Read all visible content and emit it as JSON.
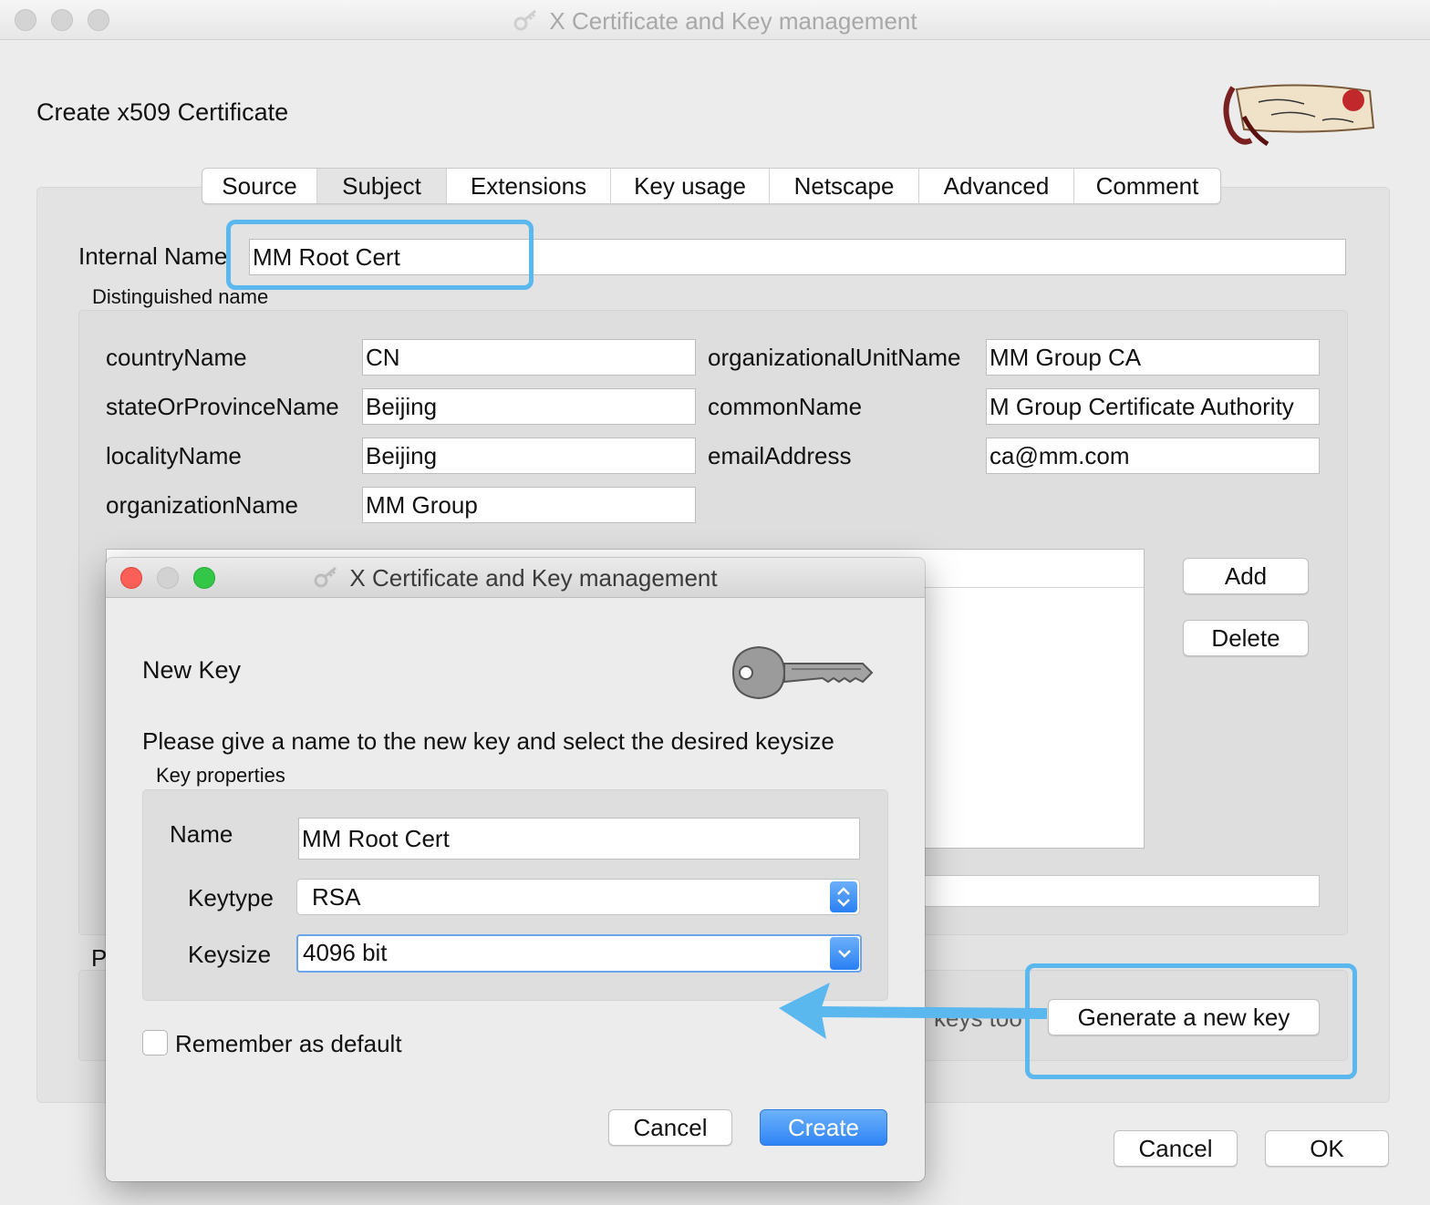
{
  "window": {
    "title": "X Certificate and Key management",
    "heading": "Create x509 Certificate"
  },
  "tabs": [
    "Source",
    "Subject",
    "Extensions",
    "Key usage",
    "Netscape",
    "Advanced",
    "Comment"
  ],
  "active_tab": "Subject",
  "subject": {
    "internal_name_label": "Internal Name",
    "internal_name_value": "MM Root Cert",
    "dn_group_label": "Distinguished name",
    "fields": {
      "countryName": {
        "label": "countryName",
        "value": "CN"
      },
      "stateOrProvinceName": {
        "label": "stateOrProvinceName",
        "value": "Beijing"
      },
      "localityName": {
        "label": "localityName",
        "value": "Beijing"
      },
      "organizationName": {
        "label": "organizationName",
        "value": "MM Group"
      },
      "organizationalUnitName": {
        "label": "organizationalUnitName",
        "value": "MM Group CA"
      },
      "commonName": {
        "label": "commonName",
        "value": "M Group Certificate Authority"
      },
      "emailAddress": {
        "label": "emailAddress",
        "value": "ca@mm.com"
      }
    },
    "add_label": "Add",
    "delete_label": "Delete",
    "private_key_group_partial": "P",
    "partial_text": "keys too",
    "generate_key_label": "Generate a new key"
  },
  "footer": {
    "cancel_label": "Cancel",
    "ok_label": "OK"
  },
  "dialog": {
    "title": "X Certificate and Key management",
    "heading": "New Key",
    "description": "Please give a name to the new key and select the desired keysize",
    "group_label": "Key properties",
    "name_label": "Name",
    "name_value": "MM Root Cert",
    "keytype_label": "Keytype",
    "keytype_value": "RSA",
    "keysize_label": "Keysize",
    "keysize_value": "4096 bit",
    "remember_label": "Remember as default",
    "remember_checked": false,
    "cancel_label": "Cancel",
    "create_label": "Create"
  },
  "colors": {
    "annotation": "#5bb8ee",
    "accent": "#2f84f5",
    "close": "#fc5f57",
    "zoom": "#33c748"
  }
}
